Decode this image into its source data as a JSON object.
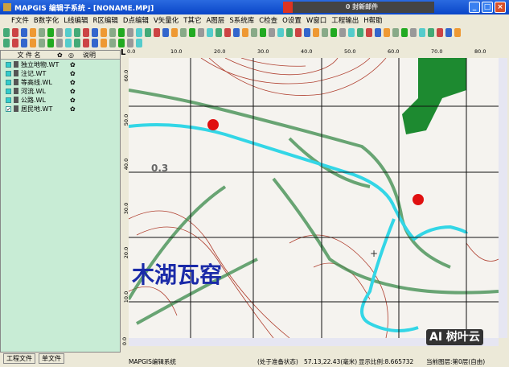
{
  "window": {
    "title": "MAPGIS 编辑子系统 - [NONAME.MPJ]",
    "notification": "0 封新邮件"
  },
  "menu": [
    "F文件",
    "B数字化",
    "L线编辑",
    "R区编辑",
    "D点编辑",
    "V矢量化",
    "T其它",
    "A图层",
    "S系统库",
    "C检查",
    "O设置",
    "W窗口",
    "工程输出",
    "H帮助"
  ],
  "panel": {
    "headers": [
      "文 件 名",
      "说明"
    ],
    "files": [
      {
        "name": "独立地物.WT",
        "checked": false
      },
      {
        "name": "注记.WT",
        "checked": false
      },
      {
        "name": "等高线.WL",
        "checked": false
      },
      {
        "name": "河流.WL",
        "checked": false
      },
      {
        "name": "公路.WL",
        "checked": false
      },
      {
        "name": "居民地.WT",
        "checked": true
      }
    ],
    "tabs": [
      "工程文件",
      "单文件"
    ]
  },
  "ruler": {
    "corner": "L",
    "top": [
      "0.0",
      "10.0",
      "20.0",
      "30.0",
      "40.0",
      "50.0",
      "60.0",
      "70.0",
      "80.0"
    ],
    "left": [
      "60.0",
      "50.0",
      "40.0",
      "30.0",
      "20.0",
      "10.0",
      "0.0"
    ]
  },
  "map": {
    "label": "木湖瓦窑",
    "annotation": "0.3"
  },
  "status": {
    "app": "MAPGIS编辑系统",
    "state": "(处于准备状态)",
    "coords": "57.13,22.43(毫米)",
    "scale": "显示比例:8.665732",
    "layer": "当前图层:第0层(自由)"
  },
  "watermark": "AI 树叶云",
  "colors": {
    "river": "#33d6e6",
    "road": "#3a8a4a",
    "contour": "#b04030",
    "label": "#1a2aa8",
    "residence": "#1d8a30"
  }
}
